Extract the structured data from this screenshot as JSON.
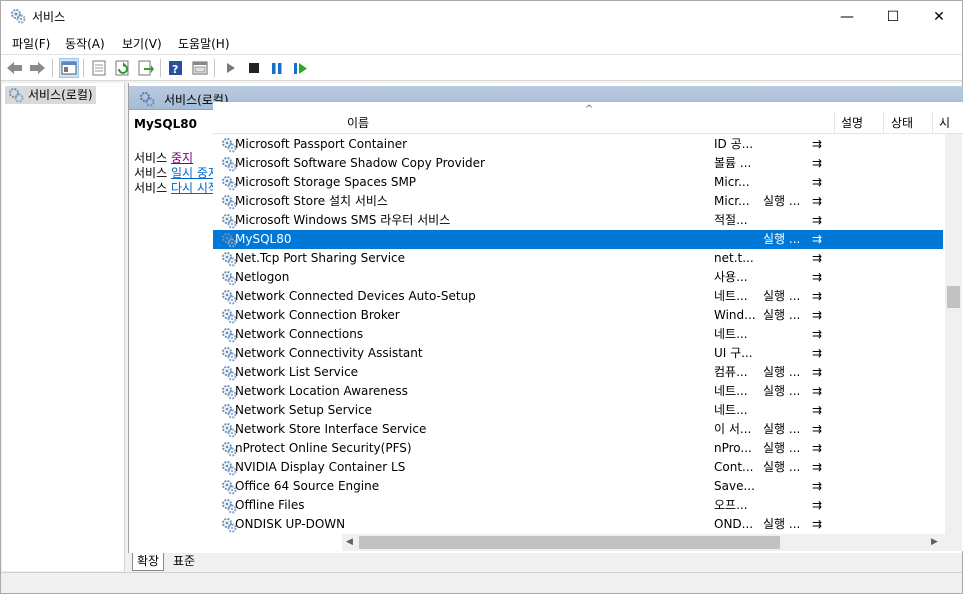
{
  "window": {
    "title": "서비스"
  },
  "window_controls": {
    "minimize": "—",
    "maximize": "☐",
    "close": "✕"
  },
  "menu": {
    "items": [
      "파일(F)",
      "동작(A)",
      "보기(V)",
      "도움말(H)"
    ]
  },
  "toolbar": {
    "icons": [
      "back-icon",
      "forward-icon",
      "show-console-tree-icon",
      "properties-icon",
      "refresh-icon",
      "export-list-icon",
      "help-icon",
      "console-icon",
      "start-service-icon",
      "stop-service-icon",
      "pause-service-icon",
      "restart-service-icon"
    ]
  },
  "tree": {
    "root_label": "서비스(로컬)"
  },
  "pane": {
    "header": "서비스(로컬)"
  },
  "detail": {
    "service_name": "MySQL80",
    "actions": [
      {
        "prefix": "서비스",
        "link": "중지"
      },
      {
        "prefix": "서비스",
        "link": "일시 중지"
      },
      {
        "prefix": "서비스",
        "link": "다시 시작"
      }
    ]
  },
  "columns": {
    "name": "이름",
    "description": "설명",
    "status": "상태",
    "startup": "시"
  },
  "services": [
    {
      "name": "Microsoft Passport Container",
      "description": "ID 공...",
      "status": "",
      "startup": "⇉"
    },
    {
      "name": "Microsoft Software Shadow Copy Provider",
      "description": "볼륨 ...",
      "status": "",
      "startup": "⇉"
    },
    {
      "name": "Microsoft Storage Spaces SMP",
      "description": "Micr...",
      "status": "",
      "startup": "⇉"
    },
    {
      "name": "Microsoft Store 설치 서비스",
      "description": "Micr...",
      "status": "실행 ...",
      "startup": "⇉"
    },
    {
      "name": "Microsoft Windows SMS 라우터 서비스",
      "description": "적절...",
      "status": "",
      "startup": "⇉"
    },
    {
      "name": "MySQL80",
      "description": "",
      "status": "실행 ...",
      "startup": "⇉",
      "selected": true
    },
    {
      "name": "Net.Tcp Port Sharing Service",
      "description": "net.t...",
      "status": "",
      "startup": "⇉"
    },
    {
      "name": "Netlogon",
      "description": "사용...",
      "status": "",
      "startup": "⇉"
    },
    {
      "name": "Network Connected Devices Auto-Setup",
      "description": "네트...",
      "status": "실행 ...",
      "startup": "⇉"
    },
    {
      "name": "Network Connection Broker",
      "description": "Wind...",
      "status": "실행 ...",
      "startup": "⇉"
    },
    {
      "name": "Network Connections",
      "description": "네트...",
      "status": "",
      "startup": "⇉"
    },
    {
      "name": "Network Connectivity Assistant",
      "description": "UI 구...",
      "status": "",
      "startup": "⇉"
    },
    {
      "name": "Network List Service",
      "description": "컴퓨...",
      "status": "실행 ...",
      "startup": "⇉"
    },
    {
      "name": "Network Location Awareness",
      "description": "네트...",
      "status": "실행 ...",
      "startup": "⇉"
    },
    {
      "name": "Network Setup Service",
      "description": "네트...",
      "status": "",
      "startup": "⇉"
    },
    {
      "name": "Network Store Interface Service",
      "description": "이 서...",
      "status": "실행 ...",
      "startup": "⇉"
    },
    {
      "name": "nProtect Online Security(PFS)",
      "description": "nPro...",
      "status": "실행 ...",
      "startup": "⇉"
    },
    {
      "name": "NVIDIA Display Container LS",
      "description": "Cont...",
      "status": "실행 ...",
      "startup": "⇉"
    },
    {
      "name": "Office 64 Source Engine",
      "description": "Save...",
      "status": "",
      "startup": "⇉"
    },
    {
      "name": "Offline Files",
      "description": "오프...",
      "status": "",
      "startup": "⇉"
    },
    {
      "name": "ONDISK UP-DOWN",
      "description": "OND...",
      "status": "실행 ...",
      "startup": "⇉"
    }
  ],
  "tabs": [
    "확장",
    "표준"
  ],
  "colors": {
    "selection": "#0078d7",
    "header_gradient": "#b9cbe0",
    "link": "#0066cc"
  }
}
